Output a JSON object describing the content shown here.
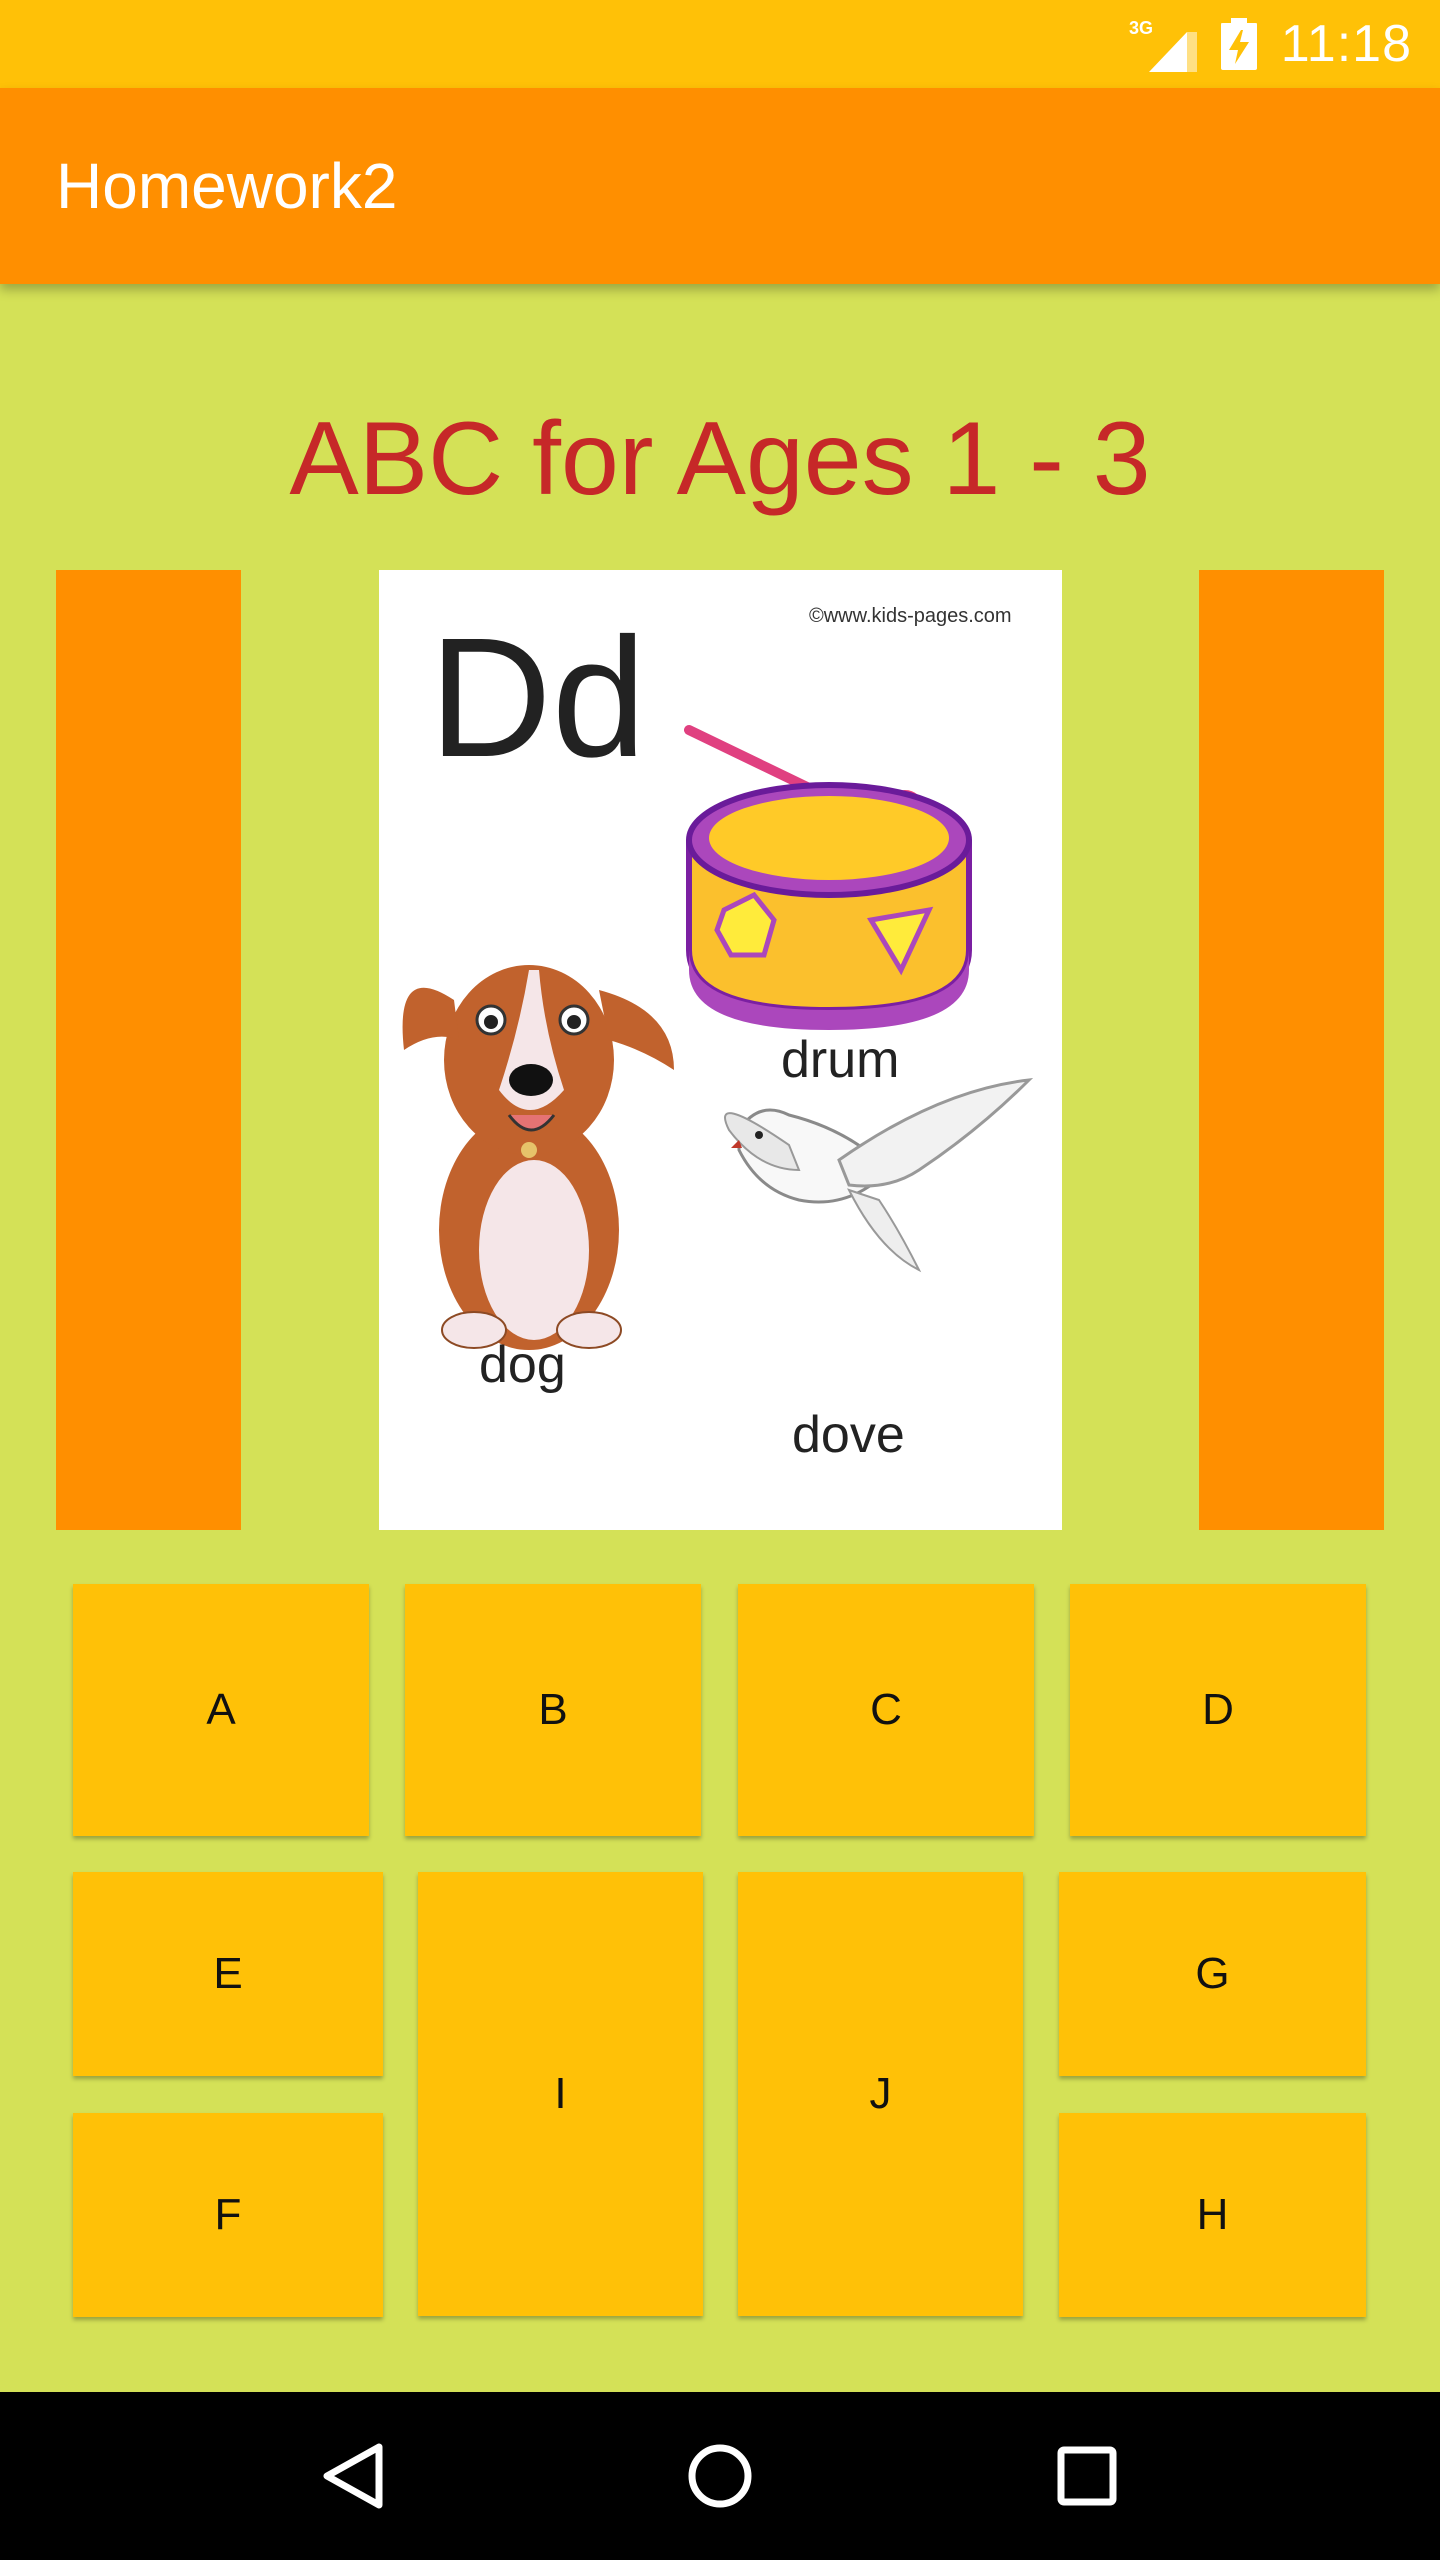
{
  "status_bar": {
    "network": "3G",
    "time": "11:18",
    "icons": [
      "signal-3g-icon",
      "battery-charging-icon"
    ]
  },
  "app_bar": {
    "title": "Homework2"
  },
  "main": {
    "heading": "ABC for Ages 1 - 3",
    "card": {
      "letter": "Dd",
      "copyright": "©www.kids-pages.com",
      "words": [
        "drum",
        "dog",
        "dove"
      ]
    },
    "buttons": [
      "A",
      "B",
      "C",
      "D",
      "E",
      "I",
      "J",
      "G",
      "F",
      "H"
    ]
  },
  "nav_bar": {
    "icons": [
      "back-icon",
      "home-icon",
      "recents-icon"
    ]
  },
  "colors": {
    "status_bar": "#ffc107",
    "app_bar": "#ff8f00",
    "background": "#d4e157",
    "heading": "#c62828",
    "button": "#ffc107",
    "side_panel": "#ff8f00"
  }
}
